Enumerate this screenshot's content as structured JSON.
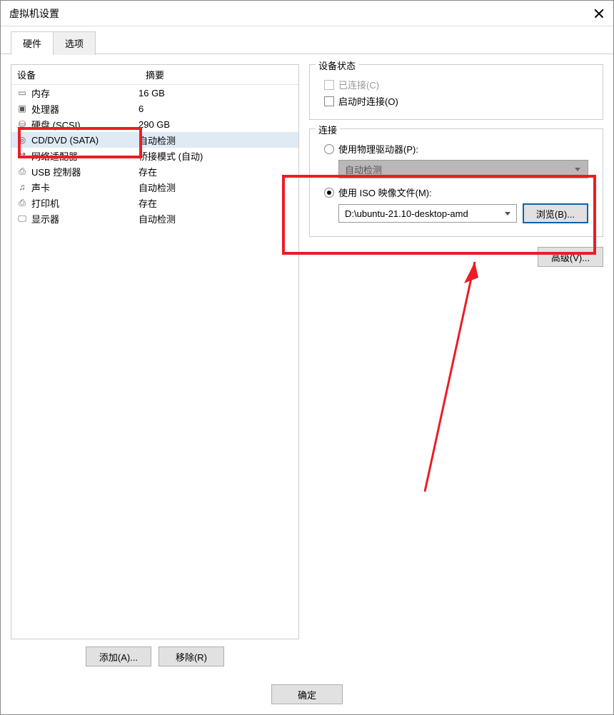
{
  "window": {
    "title": "虚拟机设置"
  },
  "tabs": {
    "hardware": "硬件",
    "options": "选项"
  },
  "table": {
    "col_device": "设备",
    "col_summary": "摘要",
    "rows": [
      {
        "icon": "memory",
        "name": "内存",
        "summary": "16 GB"
      },
      {
        "icon": "cpu",
        "name": "处理器",
        "summary": "6"
      },
      {
        "icon": "disk",
        "name": "硬盘 (SCSI)",
        "summary": "290 GB"
      },
      {
        "icon": "disc",
        "name": "CD/DVD (SATA)",
        "summary": "自动检测"
      },
      {
        "icon": "net",
        "name": "网络适配器",
        "summary": "桥接模式 (自动)"
      },
      {
        "icon": "usb",
        "name": "USB 控制器",
        "summary": "存在"
      },
      {
        "icon": "sound",
        "name": "声卡",
        "summary": "自动检测"
      },
      {
        "icon": "printer",
        "name": "打印机",
        "summary": "存在"
      },
      {
        "icon": "display",
        "name": "显示器",
        "summary": "自动检测"
      }
    ]
  },
  "left_actions": {
    "add": "添加(A)...",
    "remove": "移除(R)"
  },
  "device_status": {
    "title": "设备状态",
    "connected": "已连接(C)",
    "connect_at_poweron": "启动时连接(O)"
  },
  "connection": {
    "title": "连接",
    "use_physical": "使用物理驱动器(P):",
    "physical_value": "自动检测",
    "use_iso": "使用 ISO 映像文件(M):",
    "iso_path": "D:\\ubuntu-21.10-desktop-amd",
    "browse": "浏览(B)..."
  },
  "advanced": "高级(V)...",
  "footer": {
    "ok": "确定"
  }
}
